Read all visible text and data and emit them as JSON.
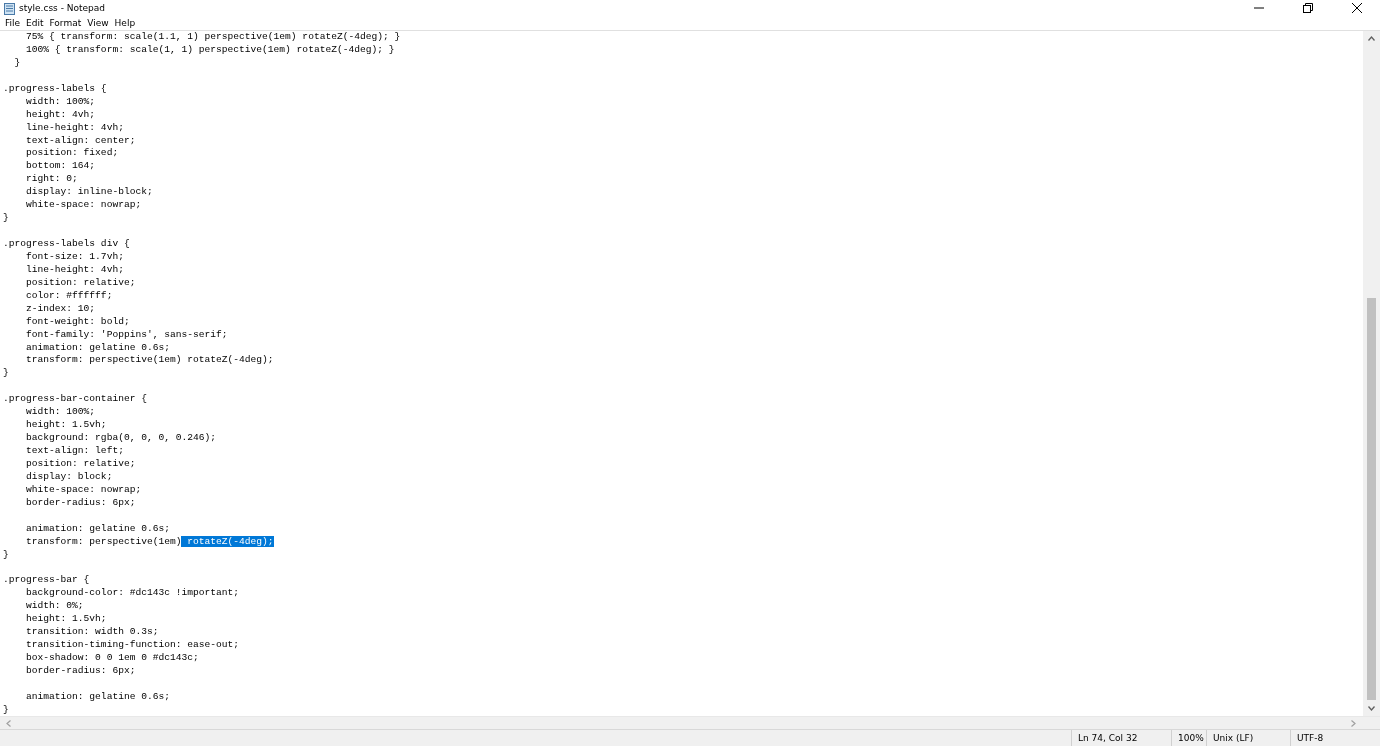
{
  "window": {
    "title": "style.css - Notepad"
  },
  "menu": [
    "File",
    "Edit",
    "Format",
    "View",
    "Help"
  ],
  "editor": {
    "lines": [
      {
        "kind": "code",
        "text": "    75% { transform: scale(1.1, 1) perspective(1em) rotateZ(-4deg); }"
      },
      {
        "kind": "code",
        "text": "    100% { transform: scale(1, 1) perspective(1em) rotateZ(-4deg); }"
      },
      {
        "kind": "code",
        "text": "  }"
      },
      {
        "kind": "blank"
      },
      {
        "kind": "code",
        "text": ".progress-labels {"
      },
      {
        "kind": "code",
        "text": "    width: 100%;"
      },
      {
        "kind": "code",
        "text": "    height: 4vh;"
      },
      {
        "kind": "code",
        "text": "    line-height: 4vh;"
      },
      {
        "kind": "code",
        "text": "    text-align: center;"
      },
      {
        "kind": "code",
        "text": "    position: fixed;"
      },
      {
        "kind": "code",
        "text": "    bottom: 164;"
      },
      {
        "kind": "code",
        "text": "    right: 0;"
      },
      {
        "kind": "code",
        "text": "    display: inline-block;"
      },
      {
        "kind": "code",
        "text": "    white-space: nowrap;"
      },
      {
        "kind": "code",
        "text": "}"
      },
      {
        "kind": "blank"
      },
      {
        "kind": "code",
        "text": ".progress-labels div {"
      },
      {
        "kind": "code",
        "text": "    font-size: 1.7vh;"
      },
      {
        "kind": "code",
        "text": "    line-height: 4vh;"
      },
      {
        "kind": "code",
        "text": "    position: relative;"
      },
      {
        "kind": "code",
        "text": "    color: #ffffff;"
      },
      {
        "kind": "code",
        "text": "    z-index: 10;"
      },
      {
        "kind": "code",
        "text": "    font-weight: bold;"
      },
      {
        "kind": "code",
        "text": "    font-family: 'Poppins', sans-serif;"
      },
      {
        "kind": "code",
        "text": "    animation: gelatine 0.6s;"
      },
      {
        "kind": "code",
        "text": "    transform: perspective(1em) rotateZ(-4deg);"
      },
      {
        "kind": "code",
        "text": "}"
      },
      {
        "kind": "blank"
      },
      {
        "kind": "code",
        "text": ".progress-bar-container {"
      },
      {
        "kind": "code",
        "text": "    width: 100%;"
      },
      {
        "kind": "code",
        "text": "    height: 1.5vh;"
      },
      {
        "kind": "code",
        "text": "    background: rgba(0, 0, 0, 0.246);"
      },
      {
        "kind": "code",
        "text": "    text-align: left;"
      },
      {
        "kind": "code",
        "text": "    position: relative;"
      },
      {
        "kind": "code",
        "text": "    display: block;"
      },
      {
        "kind": "code",
        "text": "    white-space: nowrap;"
      },
      {
        "kind": "code",
        "text": "    border-radius: 6px;"
      },
      {
        "kind": "blank"
      },
      {
        "kind": "code",
        "text": "    animation: gelatine 0.6s;"
      },
      {
        "kind": "code",
        "text": "    transform: perspective(1em)",
        "selected_text": " rotateZ(-4deg);"
      },
      {
        "kind": "code",
        "text": "}"
      },
      {
        "kind": "blank"
      },
      {
        "kind": "code",
        "text": ".progress-bar {"
      },
      {
        "kind": "code",
        "text": "    background-color: #dc143c !important;"
      },
      {
        "kind": "code",
        "text": "    width: 0%;"
      },
      {
        "kind": "code",
        "text": "    height: 1.5vh;"
      },
      {
        "kind": "code",
        "text": "    transition: width 0.3s;"
      },
      {
        "kind": "code",
        "text": "    transition-timing-function: ease-out;"
      },
      {
        "kind": "code",
        "text": "    box-shadow: 0 0 1em 0 #dc143c;"
      },
      {
        "kind": "code",
        "text": "    border-radius: 6px;"
      },
      {
        "kind": "blank"
      },
      {
        "kind": "code",
        "text": "    animation: gelatine 0.6s;"
      },
      {
        "kind": "code",
        "text": "}"
      }
    ]
  },
  "status_bar": [
    "Ln 74, Col 32",
    "100%",
    "Unix (LF)",
    "UTF-8"
  ]
}
